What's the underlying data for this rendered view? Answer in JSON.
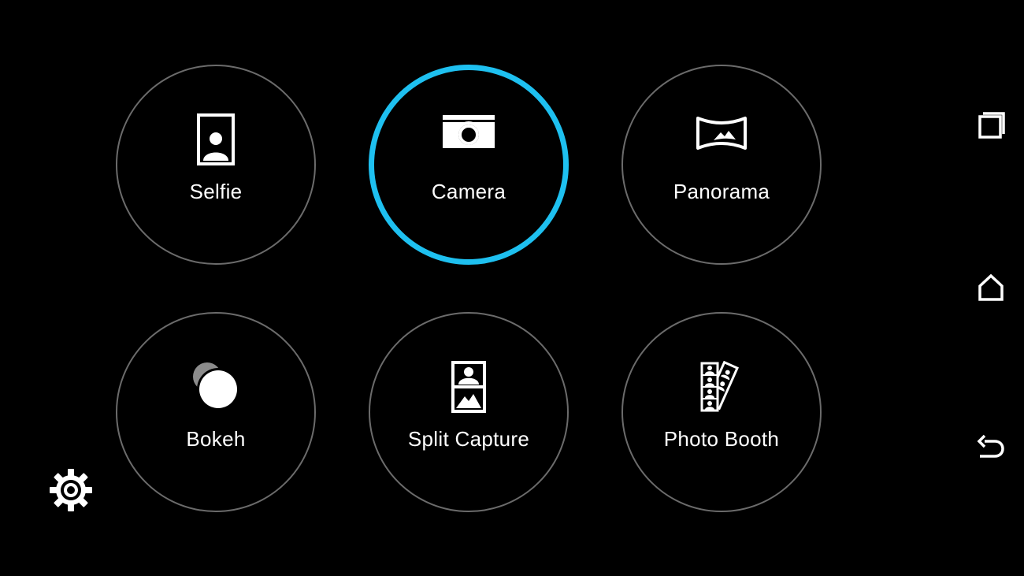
{
  "modes": [
    {
      "id": "selfie",
      "label": "Selfie",
      "icon": "selfie-portrait-icon",
      "selected": false
    },
    {
      "id": "camera",
      "label": "Camera",
      "icon": "camera-icon",
      "selected": true
    },
    {
      "id": "panorama",
      "label": "Panorama",
      "icon": "panorama-icon",
      "selected": false
    },
    {
      "id": "bokeh",
      "label": "Bokeh",
      "icon": "bokeh-icon",
      "selected": false
    },
    {
      "id": "split",
      "label": "Split Capture",
      "icon": "split-capture-icon",
      "selected": false
    },
    {
      "id": "booth",
      "label": "Photo Booth",
      "icon": "photo-booth-icon",
      "selected": false
    }
  ],
  "settings": {
    "icon": "gear-icon"
  },
  "navigation": {
    "recents": {
      "icon": "recents-icon"
    },
    "home": {
      "icon": "home-icon"
    },
    "back": {
      "icon": "back-icon"
    }
  },
  "colors": {
    "background": "#000000",
    "selected_ring": "#1ec0f0",
    "ring": "#6b6b6b",
    "text": "#ffffff"
  }
}
